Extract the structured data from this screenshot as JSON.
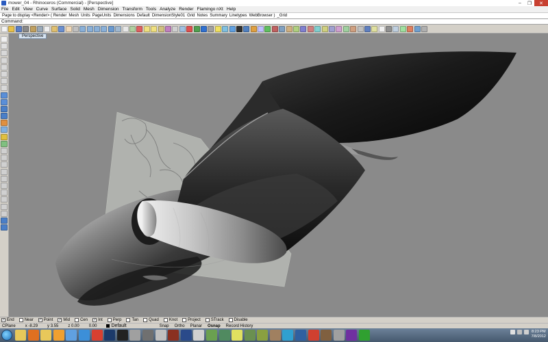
{
  "window": {
    "title": "mower_04 - Rhinoceros (Commercial) - [Perspective]",
    "controls": [
      "–",
      "❐",
      "✕"
    ]
  },
  "menu": [
    "File",
    "Edit",
    "View",
    "Curve",
    "Surface",
    "Solid",
    "Mesh",
    "Dimension",
    "Transform",
    "Tools",
    "Analyze",
    "Render",
    "Flamingo nXt",
    "Help"
  ],
  "toolbar_tabs": [
    "Page to display <Render> ( Render",
    "Mesh",
    "Units",
    "PageUnits",
    "Dimensions",
    "Default",
    "DimensionStyle01",
    "Grid",
    "Notes",
    "Summary",
    "Linetypes",
    "WebBrowser )",
    "_Grid"
  ],
  "command": {
    "label": "Command:",
    "value": ""
  },
  "main_toolbar_icons": [
    {
      "name": "new-file-icon",
      "color": "#f4f4f4"
    },
    {
      "name": "open-file-icon",
      "color": "#e8c14a"
    },
    {
      "name": "save-icon",
      "color": "#5b7fc6"
    },
    {
      "name": "print-icon",
      "color": "#8a8a8a"
    },
    {
      "name": "import-icon",
      "color": "#c0a060"
    },
    {
      "name": "cut-icon",
      "color": "#9aa9b8"
    },
    {
      "name": "copy-icon",
      "color": "#f0f0f0"
    },
    {
      "name": "paste-icon",
      "color": "#e0c070"
    },
    {
      "name": "undo-icon",
      "color": "#6a8fd0"
    },
    {
      "name": "pan-hand-icon",
      "color": "#f0d8b8"
    },
    {
      "name": "rotate-view-icon",
      "color": "#c0c0c0"
    },
    {
      "name": "zoom-icon",
      "color": "#8ab0d8"
    },
    {
      "name": "zoom-window-icon",
      "color": "#8ab0d8"
    },
    {
      "name": "zoom-extents-icon",
      "color": "#8ab0d8"
    },
    {
      "name": "zoom-selected-icon",
      "color": "#8ab0d8"
    },
    {
      "name": "zoom-target-icon",
      "color": "#6a9ad0"
    },
    {
      "name": "undo-view-icon",
      "color": "#a0b8d0"
    },
    {
      "name": "four-views-icon",
      "color": "#e8e8e8"
    },
    {
      "name": "cplane-icon",
      "color": "#b0d0a0"
    },
    {
      "name": "select-icon",
      "color": "#e06060"
    },
    {
      "name": "hide-icon",
      "color": "#f0e080"
    },
    {
      "name": "show-icon",
      "color": "#f0e080"
    },
    {
      "name": "lock-icon",
      "color": "#d0c080"
    },
    {
      "name": "layer-icon",
      "color": "#c080c0"
    },
    {
      "name": "properties-icon",
      "color": "#d0d0d0"
    },
    {
      "name": "wireframe-icon",
      "color": "#a0c0e0"
    },
    {
      "name": "shaded-icon",
      "color": "#e05050"
    },
    {
      "name": "rendered-icon",
      "color": "#50a050"
    },
    {
      "name": "render-icon",
      "color": "#3070d0"
    },
    {
      "name": "material-icon",
      "color": "#a0a0a0"
    },
    {
      "name": "light-icon",
      "color": "#f0e060"
    },
    {
      "name": "analyze-icon",
      "color": "#80c0e0"
    },
    {
      "name": "curvature-icon",
      "color": "#60a0e0"
    },
    {
      "name": "zebra-icon",
      "color": "#303030"
    },
    {
      "name": "environment-icon",
      "color": "#5080c0"
    },
    {
      "name": "draft-angle-icon",
      "color": "#e0a040"
    },
    {
      "name": "emap-icon",
      "color": "#c0c0ff"
    },
    {
      "name": "points-on-icon",
      "color": "#60c060"
    },
    {
      "name": "points-off-icon",
      "color": "#c06060"
    },
    {
      "name": "edit-points-icon",
      "color": "#80a0c0"
    },
    {
      "name": "group-icon",
      "color": "#d0b080"
    },
    {
      "name": "ungroup-icon",
      "color": "#b0d080"
    },
    {
      "name": "block-icon",
      "color": "#8080d0"
    },
    {
      "name": "explode-icon",
      "color": "#d08080"
    },
    {
      "name": "join-icon",
      "color": "#80d0d0"
    },
    {
      "name": "trim-icon",
      "color": "#d0d080"
    },
    {
      "name": "split-icon",
      "color": "#a0a0d0"
    },
    {
      "name": "rebuild-icon",
      "color": "#d0a0d0"
    },
    {
      "name": "boolean-icon",
      "color": "#a0d0a0"
    },
    {
      "name": "fillet-icon",
      "color": "#d0a080"
    },
    {
      "name": "history-icon",
      "color": "#c0c0c0"
    },
    {
      "name": "help-icon",
      "color": "#6080c0"
    },
    {
      "name": "dimension-icon",
      "color": "#e0e0a0"
    },
    {
      "name": "text-icon",
      "color": "#f0f0f0"
    },
    {
      "name": "hatch-icon",
      "color": "#909090"
    },
    {
      "name": "leader-icon",
      "color": "#c0d0e0"
    },
    {
      "name": "check-icon",
      "color": "#a0e0a0"
    },
    {
      "name": "flamingo-icon",
      "color": "#e08060"
    },
    {
      "name": "snapshot-icon",
      "color": "#70a0d0"
    },
    {
      "name": "options-icon",
      "color": "#b0b0b0"
    }
  ],
  "left_tools": [
    {
      "name": "select-arrow-icon",
      "color": "#f0f0f0"
    },
    {
      "name": "point-icon",
      "color": "#e0e0e0"
    },
    {
      "name": "polyline-icon",
      "color": "#d8d8d8"
    },
    {
      "name": "curve-icon",
      "color": "#d8d8d8"
    },
    {
      "name": "circle-icon",
      "color": "#d8d8d8"
    },
    {
      "name": "arc-icon",
      "color": "#d8d8d8"
    },
    {
      "name": "ellipse-icon",
      "color": "#d8d8d8"
    },
    {
      "name": "rectangle-icon",
      "color": "#d8d8d8"
    },
    {
      "name": "surface-from-curves-icon",
      "color": "#5a8fd8"
    },
    {
      "name": "extrude-icon",
      "color": "#5a8fd8"
    },
    {
      "name": "box-icon",
      "color": "#4a7fc8"
    },
    {
      "name": "sphere-icon",
      "color": "#4a7fc8"
    },
    {
      "name": "boolean-union-icon",
      "color": "#e09040"
    },
    {
      "name": "mesh-icon",
      "color": "#80b0e0"
    },
    {
      "name": "fillet-edge-icon",
      "color": "#e0c040"
    },
    {
      "name": "offset-icon",
      "color": "#80c080"
    },
    {
      "name": "trim-tool-icon",
      "color": "#d0d0d0"
    },
    {
      "name": "split-tool-icon",
      "color": "#d0d0d0"
    },
    {
      "name": "join-tool-icon",
      "color": "#d0d0d0"
    },
    {
      "name": "move-icon",
      "color": "#d0d0d0"
    },
    {
      "name": "rotate-icon",
      "color": "#d0d0d0"
    },
    {
      "name": "scale-icon",
      "color": "#d0d0d0"
    },
    {
      "name": "mirror-icon",
      "color": "#d0d0d0"
    },
    {
      "name": "array-icon",
      "color": "#d0d0d0"
    },
    {
      "name": "dimension-tool-icon",
      "color": "#d0d0d0"
    },
    {
      "name": "text-tool-icon",
      "color": "#d0d0d0"
    },
    {
      "name": "analyze-tool-icon",
      "color": "#4a7fc8"
    },
    {
      "name": "render-tool-icon",
      "color": "#4a7fc8"
    }
  ],
  "viewport": {
    "label": "Perspective",
    "background": "#8a8a8a"
  },
  "osnaps": [
    {
      "label": "End",
      "checked": true
    },
    {
      "label": "Near",
      "checked": false
    },
    {
      "label": "Point",
      "checked": true
    },
    {
      "label": "Mid",
      "checked": true
    },
    {
      "label": "Cen",
      "checked": false
    },
    {
      "label": "Int",
      "checked": true
    },
    {
      "label": "Perp",
      "checked": false
    },
    {
      "label": "Tan",
      "checked": false
    },
    {
      "label": "Quad",
      "checked": false
    },
    {
      "label": "Knot",
      "checked": false
    },
    {
      "label": "Project",
      "checked": false
    },
    {
      "label": "STrack",
      "checked": false
    },
    {
      "label": "Disable",
      "checked": false
    }
  ],
  "status": {
    "cplane": "CPlane",
    "x": "x -8.29",
    "y": "y 3.55",
    "z": "z 0.00",
    "units": "0.00",
    "layer": "Default",
    "modes": [
      "Snap",
      "Ortho",
      "Planar",
      "Osnap",
      "Record History"
    ]
  },
  "taskbar": {
    "apps": [
      {
        "name": "explorer-icon",
        "color": "#e8c85a"
      },
      {
        "name": "firefox-icon",
        "color": "#e07020"
      },
      {
        "name": "folder-icon",
        "color": "#e8c85a"
      },
      {
        "name": "media-player-icon",
        "color": "#f0a030"
      },
      {
        "name": "itunes-icon",
        "color": "#60a0e0"
      },
      {
        "name": "ie-icon",
        "color": "#3c8fd8"
      },
      {
        "name": "chrome-icon",
        "color": "#d84030"
      },
      {
        "name": "photoshop-icon",
        "color": "#1c3a6a"
      },
      {
        "name": "app-icon-1",
        "color": "#222222"
      },
      {
        "name": "app-icon-2",
        "color": "#a0a0a0"
      },
      {
        "name": "app-icon-3",
        "color": "#707070"
      },
      {
        "name": "app-icon-4",
        "color": "#c0c0c0"
      },
      {
        "name": "app-icon-5",
        "color": "#8a3020"
      },
      {
        "name": "app-icon-6",
        "color": "#2a4a8a"
      },
      {
        "name": "app-icon-7",
        "color": "#d0d0d0"
      },
      {
        "name": "app-icon-8",
        "color": "#6aa050"
      },
      {
        "name": "app-icon-9",
        "color": "#508a60"
      },
      {
        "name": "app-icon-10",
        "color": "#e0e060"
      },
      {
        "name": "app-icon-11",
        "color": "#6a9050"
      },
      {
        "name": "app-icon-12",
        "color": "#8aa040"
      },
      {
        "name": "app-icon-13",
        "color": "#a08060"
      },
      {
        "name": "app-icon-14",
        "color": "#30a0d0"
      },
      {
        "name": "app-icon-15",
        "color": "#3060a0"
      },
      {
        "name": "app-icon-16",
        "color": "#d04030"
      },
      {
        "name": "app-icon-17",
        "color": "#806040"
      },
      {
        "name": "app-icon-18",
        "color": "#a0a0a0"
      },
      {
        "name": "app-icon-19",
        "color": "#7030a0"
      },
      {
        "name": "app-icon-20",
        "color": "#30a030"
      }
    ],
    "time": "8:23 PM",
    "date": "7/8/2012"
  }
}
